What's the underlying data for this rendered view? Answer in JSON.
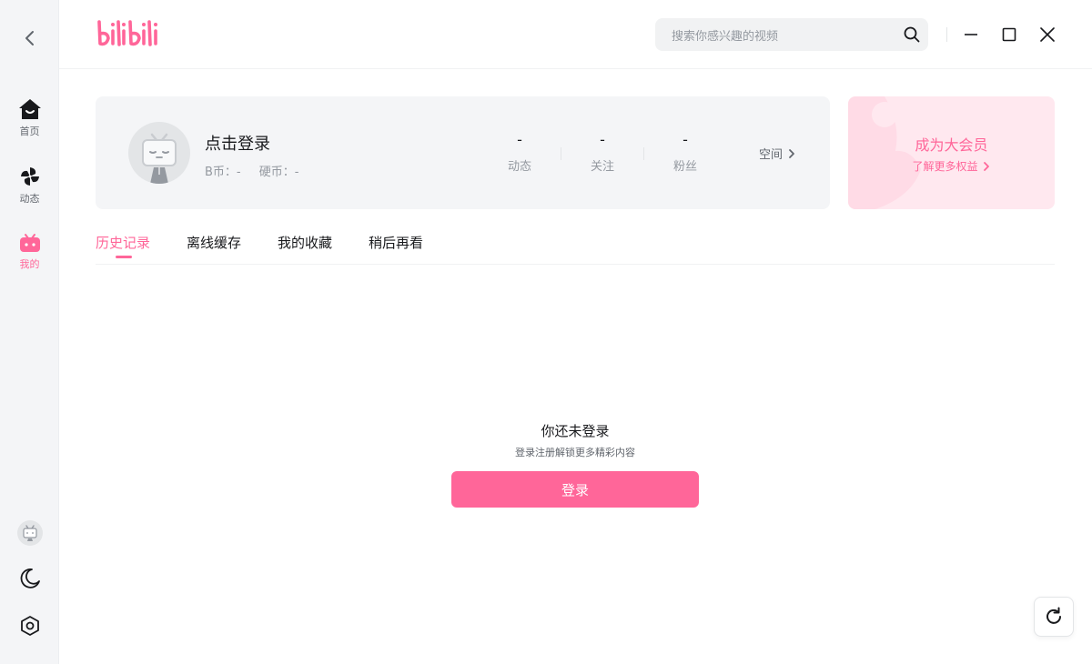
{
  "app": {
    "logo_text": "bilibili",
    "brand_color": "#ff6699"
  },
  "sidebar": {
    "back_icon": "chevron-left-icon",
    "items": [
      {
        "label": "首页",
        "icon": "home-icon",
        "active": false
      },
      {
        "label": "动态",
        "icon": "pinwheel-icon",
        "active": false
      },
      {
        "label": "我的",
        "icon": "tv-icon",
        "active": true
      }
    ],
    "bottom": [
      {
        "icon": "avatar-icon"
      },
      {
        "icon": "moon-icon"
      },
      {
        "icon": "settings-icon"
      }
    ]
  },
  "header": {
    "search_placeholder": "搜索你感兴趣的视频",
    "window_controls": [
      "minimize-icon",
      "maximize-icon",
      "close-icon"
    ]
  },
  "profile": {
    "login_prompt": "点击登录",
    "b_coin": "B币：-",
    "coin": "硬币：-",
    "stats": [
      {
        "value": "-",
        "label": "动态"
      },
      {
        "value": "-",
        "label": "关注"
      },
      {
        "value": "-",
        "label": "粉丝"
      }
    ],
    "space_link": "空间"
  },
  "vip": {
    "title": "成为大会员",
    "subtitle": "了解更多权益"
  },
  "tabs": [
    {
      "label": "历史记录",
      "active": true
    },
    {
      "label": "离线缓存",
      "active": false
    },
    {
      "label": "我的收藏",
      "active": false
    },
    {
      "label": "稍后再看",
      "active": false
    }
  ],
  "empty_state": {
    "title": "你还未登录",
    "subtitle": "登录注册解锁更多精彩内容",
    "button": "登录"
  },
  "refresh_icon": "refresh-icon"
}
